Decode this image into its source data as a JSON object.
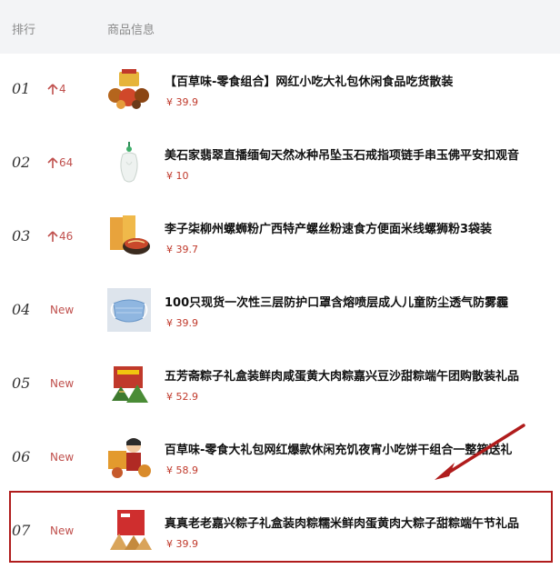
{
  "header": {
    "rank_label": "排行",
    "info_label": "商品信息"
  },
  "rows": [
    {
      "rank": "01",
      "trend": "4",
      "trend_type": "up",
      "title": "【百草味-零食组合】网红小吃大礼包休闲食品吃货散装",
      "price": "¥ 39.9",
      "thumb_icon": "snack-gift-box-icon"
    },
    {
      "rank": "02",
      "trend": "64",
      "trend_type": "up",
      "title": "美石家翡翠直播缅甸天然冰种吊坠玉石戒指项链手串玉佛平安扣观音",
      "price": "¥ 10",
      "thumb_icon": "jade-pendant-icon"
    },
    {
      "rank": "03",
      "trend": "46",
      "trend_type": "up",
      "title": "李子柒柳州螺蛳粉广西特产螺丝粉速食方便面米线螺狮粉3袋装",
      "price": "¥ 39.7",
      "thumb_icon": "noodle-bowl-icon"
    },
    {
      "rank": "04",
      "trend": "New",
      "trend_type": "new",
      "title": "100只现货一次性三层防护口罩含熔喷层成人儿童防尘透气防雾霾",
      "price": "¥ 39.9",
      "thumb_icon": "face-mask-icon"
    },
    {
      "rank": "05",
      "trend": "New",
      "trend_type": "new",
      "title": "五芳斋粽子礼盒装鲜肉咸蛋黄大肉粽嘉兴豆沙甜粽端午团购散装礼品",
      "price": "¥ 52.9",
      "thumb_icon": "zongzi-gift-box-icon"
    },
    {
      "rank": "06",
      "trend": "New",
      "trend_type": "new",
      "title": "百草味-零食大礼包网红爆款休闲充饥夜宵小吃饼干组合一整箱送礼",
      "price": "¥ 58.9",
      "thumb_icon": "snack-spokesperson-icon"
    },
    {
      "rank": "07",
      "trend": "New",
      "trend_type": "new",
      "title": "真真老老嘉兴粽子礼盒装肉粽糯米鲜肉蛋黄肉大粽子甜粽端午节礼品",
      "price": "¥ 39.9",
      "thumb_icon": "zongzi-bag-icon"
    }
  ],
  "colors": {
    "accent": "#c0392b",
    "highlight_border": "#b01c1c",
    "header_bg": "#f3f4f6"
  }
}
